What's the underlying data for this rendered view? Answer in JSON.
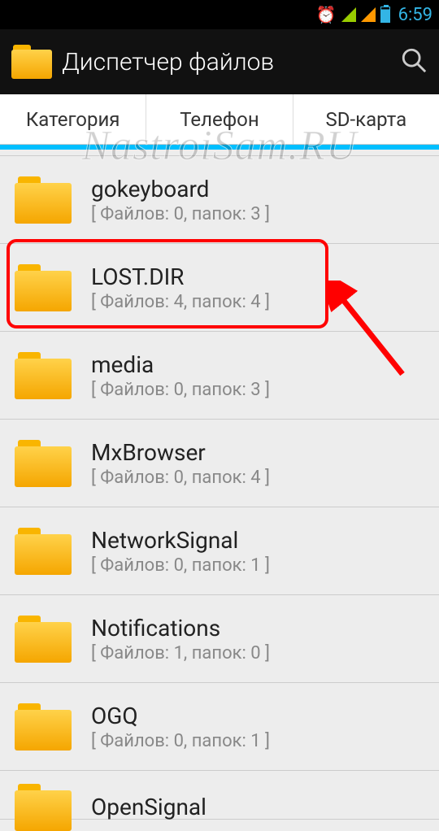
{
  "status": {
    "time": "6:59"
  },
  "header": {
    "title": "Диспетчер файлов"
  },
  "tabs": {
    "category": "Категория",
    "phone": "Телефон",
    "sdcard": "SD-карта",
    "active": "phone"
  },
  "folders": [
    {
      "name": "gokeyboard",
      "meta": "[ Файлов: 0, папок: 3 ]"
    },
    {
      "name": "LOST.DIR",
      "meta": "[ Файлов: 4, папок: 4 ]",
      "highlighted": true
    },
    {
      "name": "media",
      "meta": "[ Файлов: 0, папок: 3 ]"
    },
    {
      "name": "MxBrowser",
      "meta": "[ Файлов: 0, папок: 4 ]"
    },
    {
      "name": "NetworkSignal",
      "meta": "[ Файлов: 0, папок: 1 ]"
    },
    {
      "name": "Notifications",
      "meta": "[ Файлов: 1, папок: 0 ]"
    },
    {
      "name": "OGQ",
      "meta": "[ Файлов: 0, папок: 1 ]"
    },
    {
      "name": "OpenSignal",
      "meta": ""
    }
  ],
  "watermark": "NastroiSam.RU"
}
